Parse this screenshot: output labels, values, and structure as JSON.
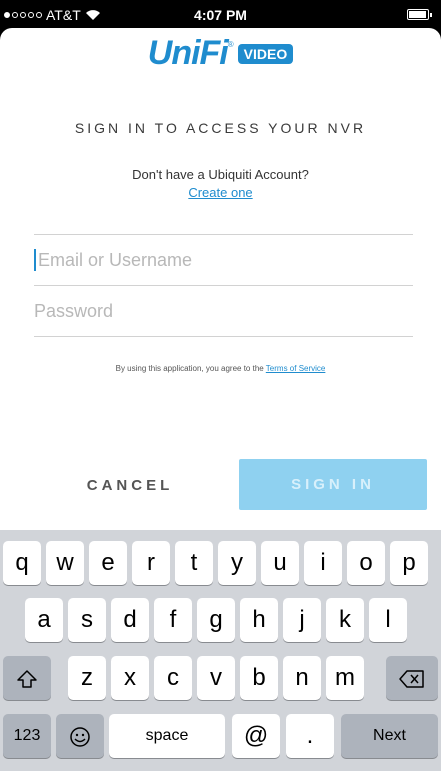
{
  "status_bar": {
    "carrier": "AT&T",
    "time": "4:07 PM",
    "signal_bars": 1,
    "signal_total": 5
  },
  "logo": {
    "brand": "UniFi",
    "registered": "®",
    "badge": "VIDEO"
  },
  "login": {
    "heading": "SIGN IN TO ACCESS YOUR NVR",
    "no_account_text": "Don't have a Ubiquiti Account?",
    "create_link": "Create one",
    "email_placeholder": "Email or Username",
    "password_placeholder": "Password",
    "terms_prefix": "By using this application, you agree to the ",
    "terms_link": "Terms of Service",
    "cancel_label": "CANCEL",
    "signin_label": "SIGN IN"
  },
  "keyboard": {
    "row1": [
      "q",
      "w",
      "e",
      "r",
      "t",
      "y",
      "u",
      "i",
      "o",
      "p"
    ],
    "row2": [
      "a",
      "s",
      "d",
      "f",
      "g",
      "h",
      "j",
      "k",
      "l"
    ],
    "row3": [
      "z",
      "x",
      "c",
      "v",
      "b",
      "n",
      "m"
    ],
    "numbers_label": "123",
    "space_label": "space",
    "at_label": "@",
    "period_label": ".",
    "next_label": "Next",
    "shift_icon": "shift-icon",
    "delete_icon": "delete-icon",
    "emoji_icon": "emoji-icon"
  },
  "colors": {
    "accent": "#1f8cce",
    "signin_bg": "#8fd1f0",
    "keyboard_bg": "#d1d4d9"
  }
}
